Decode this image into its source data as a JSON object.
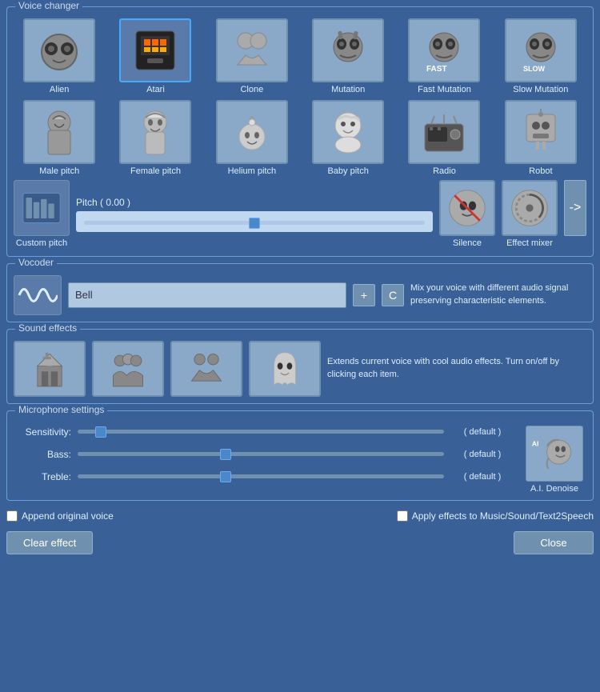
{
  "app": {
    "title": "Voice Changer"
  },
  "voice_changer": {
    "section_label": "Voice changer",
    "voices": [
      {
        "id": "alien",
        "label": "Alien",
        "selected": false
      },
      {
        "id": "atari",
        "label": "Atari",
        "selected": true
      },
      {
        "id": "clone",
        "label": "Clone",
        "selected": false
      },
      {
        "id": "mutation",
        "label": "Mutation",
        "selected": false
      },
      {
        "id": "fast_mutation",
        "label": "Fast Mutation",
        "selected": false
      },
      {
        "id": "slow_mutation",
        "label": "Slow Mutation",
        "selected": false
      },
      {
        "id": "male_pitch",
        "label": "Male pitch",
        "selected": false
      },
      {
        "id": "female_pitch",
        "label": "Female pitch",
        "selected": false
      },
      {
        "id": "helium_pitch",
        "label": "Helium pitch",
        "selected": false
      },
      {
        "id": "baby_pitch",
        "label": "Baby pitch",
        "selected": false
      },
      {
        "id": "radio",
        "label": "Radio",
        "selected": false
      },
      {
        "id": "robot",
        "label": "Robot",
        "selected": false
      }
    ],
    "pitch_label": "Pitch ( 0.00 )",
    "pitch_value": 0.0,
    "pitch_thumb_pct": 50,
    "custom_pitch_label": "Custom pitch",
    "silence_label": "Silence",
    "effect_mixer_label": "Effect mixer",
    "arrow_label": "->"
  },
  "vocoder": {
    "section_label": "Vocoder",
    "bell_option": "Bell",
    "add_btn": "+",
    "reset_btn": "C",
    "description": "Mix your voice with different audio signal preserving characteristic elements."
  },
  "sound_effects": {
    "section_label": "Sound effects",
    "description": "Extends current voice with cool audio effects. Turn on/off by clicking each item.",
    "items": [
      {
        "id": "church",
        "label": "Church"
      },
      {
        "id": "crowd",
        "label": "Crowd"
      },
      {
        "id": "people",
        "label": "People"
      },
      {
        "id": "ghost",
        "label": "Ghost"
      }
    ]
  },
  "microphone": {
    "section_label": "Microphone settings",
    "sensitivity_label": "Sensitivity:",
    "sensitivity_value": "( default )",
    "sensitivity_thumb_pct": 5,
    "bass_label": "Bass:",
    "bass_value": "( default )",
    "bass_thumb_pct": 40,
    "treble_label": "Treble:",
    "treble_value": "( default )",
    "treble_thumb_pct": 40,
    "ai_denoise_label": "A.I. Denoise"
  },
  "options": {
    "append_original": "Append original voice",
    "apply_effects": "Apply effects to Music/Sound/Text2Speech"
  },
  "buttons": {
    "clear_effect": "Clear effect",
    "close": "Close"
  }
}
